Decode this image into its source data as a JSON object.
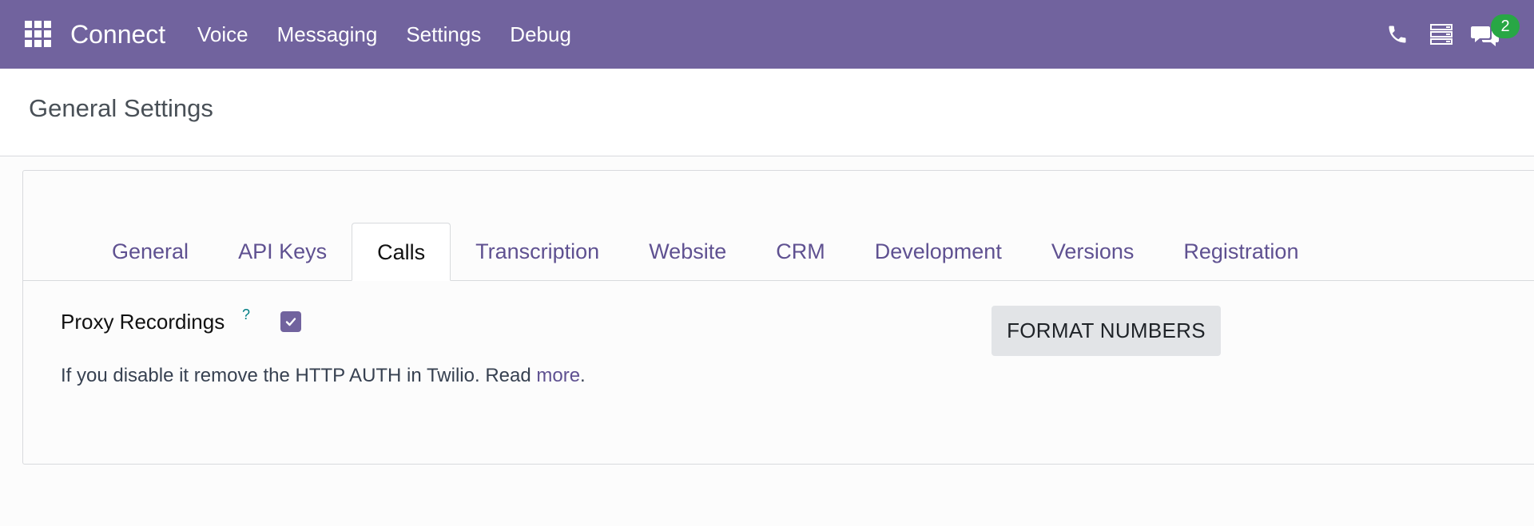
{
  "navbar": {
    "brand": "Connect",
    "menu": [
      {
        "label": "Voice"
      },
      {
        "label": "Messaging"
      },
      {
        "label": "Settings"
      },
      {
        "label": "Debug"
      }
    ],
    "systray": {
      "phone_icon": "phone-icon",
      "activity_icon": "activity-icon",
      "messaging_icon": "chat-icon",
      "messaging_badge": "2"
    },
    "bg_color": "#71639e"
  },
  "control_panel": {
    "title": "General Settings"
  },
  "settings": {
    "tabs": [
      {
        "label": "General",
        "active": false
      },
      {
        "label": "API Keys",
        "active": false
      },
      {
        "label": "Calls",
        "active": true
      },
      {
        "label": "Transcription",
        "active": false
      },
      {
        "label": "Website",
        "active": false
      },
      {
        "label": "CRM",
        "active": false
      },
      {
        "label": "Development",
        "active": false
      },
      {
        "label": "Versions",
        "active": false
      },
      {
        "label": "Registration",
        "active": false
      }
    ],
    "proxy_recordings": {
      "label": "Proxy Recordings",
      "help": "?",
      "checked": true,
      "description_prefix": "If you disable it remove the HTTP AUTH in Twilio. Read ",
      "link": "more",
      "description_suffix": "."
    },
    "format_numbers_button": "FORMAT NUMBERS"
  }
}
